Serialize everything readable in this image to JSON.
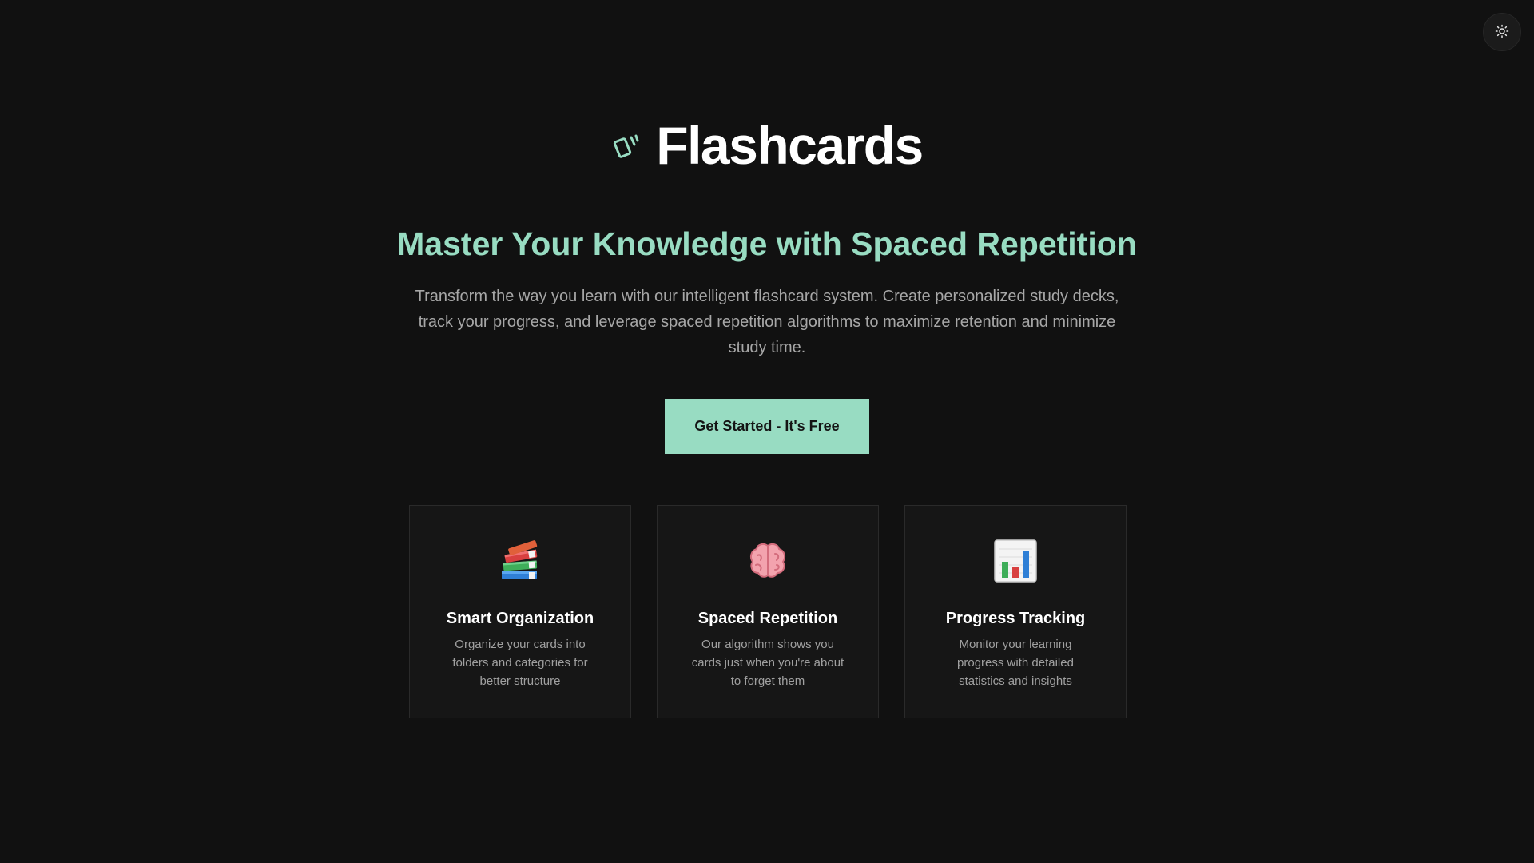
{
  "theme_toggle": {
    "icon": "sun-icon"
  },
  "brand": {
    "logo_icon": "cards-icon",
    "title": "Flashcards"
  },
  "hero": {
    "headline": "Master Your Knowledge with Spaced Repetition",
    "subtext": "Transform the way you learn with our intelligent flashcard system. Create personalized study decks, track your progress, and leverage spaced repetition algorithms to maximize retention and minimize study time.",
    "cta_label": "Get Started - It's Free"
  },
  "features": [
    {
      "icon": "books-icon",
      "title": "Smart Organization",
      "description": "Organize your cards into folders and categories for better structure"
    },
    {
      "icon": "brain-icon",
      "title": "Spaced Repetition",
      "description": "Our algorithm shows you cards just when you're about to forget them"
    },
    {
      "icon": "bar-chart-icon",
      "title": "Progress Tracking",
      "description": "Monitor your learning progress with detailed statistics and insights"
    }
  ],
  "colors": {
    "background": "#111111",
    "accent": "#98dcc2",
    "card_background": "#161616",
    "muted_text": "#a7a7a7"
  }
}
